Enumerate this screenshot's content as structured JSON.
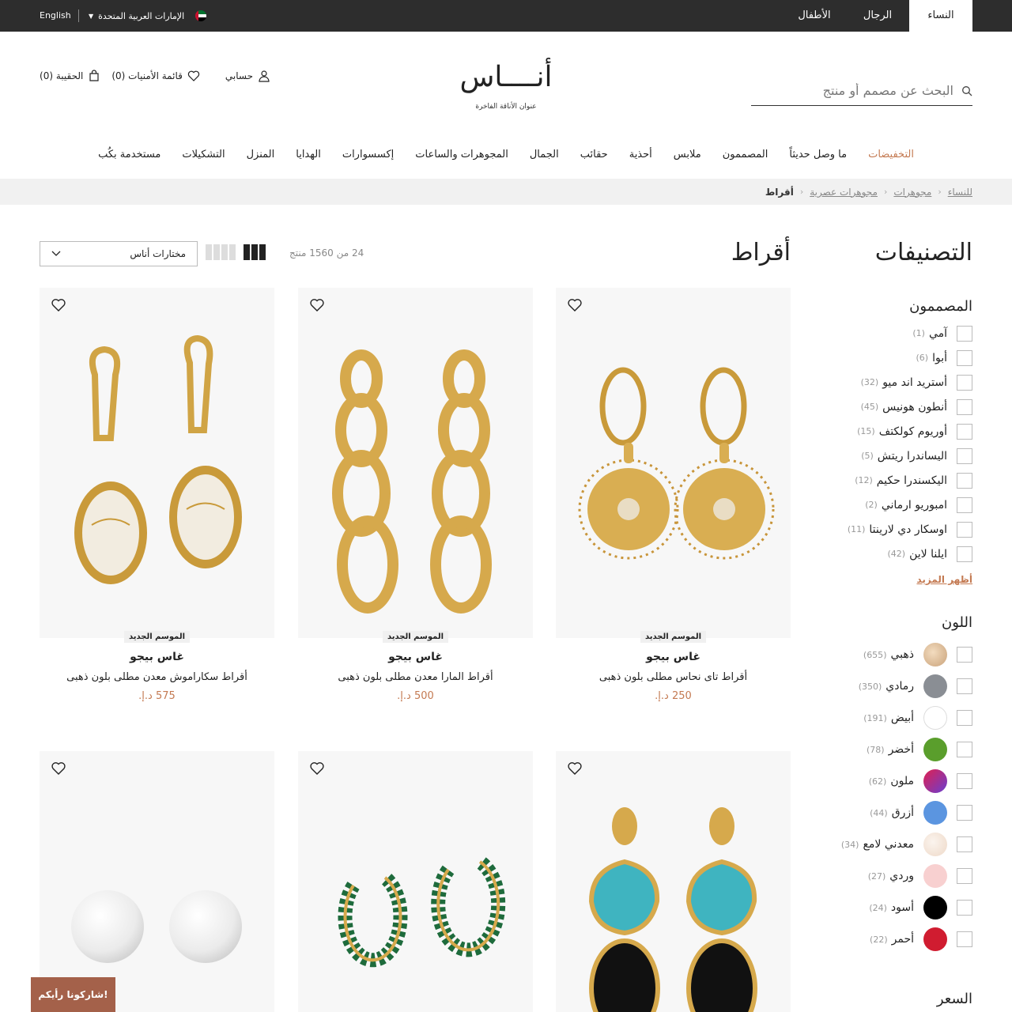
{
  "topbar": {
    "tabs": [
      "النساء",
      "الرجال",
      "الأطفال"
    ],
    "language": "English",
    "region": "الإمارات العربية المتحدة"
  },
  "header": {
    "account": "حسابي",
    "wishlist": "قائمة الأمنيات (0)",
    "bag": "الحقيبة (0)",
    "logo_text": "أنــــاس",
    "logo_tagline": "عنوان الأناقة الفاخرة",
    "search_placeholder": "البحث عن مصمم أو منتج"
  },
  "nav": [
    "التخفيضات",
    "ما وصل حديثاً",
    "المصممون",
    "ملابس",
    "أحذية",
    "حقائب",
    "الجمال",
    "المجوهرات والساعات",
    "إكسسوارات",
    "الهدايا",
    "المنزل",
    "التشكيلات",
    "مستخدمة بكُب"
  ],
  "breadcrumb": [
    "للنساء",
    "مجوهرات",
    "مجوهرات عصرية"
  ],
  "breadcrumb_current": "أقراط",
  "sidebar": {
    "title": "التصنيفات",
    "designers_title": "المصممون",
    "designers": [
      {
        "name": "آمي",
        "count": "(1)"
      },
      {
        "name": "أبوا",
        "count": "(6)"
      },
      {
        "name": "أستريد اند ميو",
        "count": "(32)"
      },
      {
        "name": "أنطون هونيس",
        "count": "(45)"
      },
      {
        "name": "أوريوم كولكتف",
        "count": "(15)"
      },
      {
        "name": "اليساندرا ريتش",
        "count": "(5)"
      },
      {
        "name": "اليكسندرا حكيم",
        "count": "(12)"
      },
      {
        "name": "امبوريو ارماني",
        "count": "(2)"
      },
      {
        "name": "اوسكار دي لارينتا",
        "count": "(11)"
      },
      {
        "name": "ايلنا لاين",
        "count": "(42)"
      }
    ],
    "show_more": "أظهر المزيد",
    "color_title": "اللون",
    "colors": [
      {
        "name": "ذهبي",
        "count": "(655)",
        "hex": "#e8c9a4"
      },
      {
        "name": "رمادي",
        "count": "(350)",
        "hex": "#8a8e94"
      },
      {
        "name": "أبيض",
        "count": "(191)",
        "hex": "#ffffff"
      },
      {
        "name": "أخضر",
        "count": "(78)",
        "hex": "#5a9e2c"
      },
      {
        "name": "ملون",
        "count": "(62)",
        "hex": "#c0305a"
      },
      {
        "name": "أزرق",
        "count": "(44)",
        "hex": "#5b95e0"
      },
      {
        "name": "معدني لامع",
        "count": "(34)",
        "hex": "#f0e2d6"
      },
      {
        "name": "وردي",
        "count": "(27)",
        "hex": "#f8d0d0"
      },
      {
        "name": "أسود",
        "count": "(24)",
        "hex": "#000000"
      },
      {
        "name": "أحمر",
        "count": "(22)",
        "hex": "#d01c30"
      }
    ],
    "price_title": "السعر"
  },
  "listing": {
    "title": "أقراط",
    "count_text": "24 من 1560 منتج",
    "sort_label": "مختارات أناس"
  },
  "products": [
    {
      "badge": "الموسم الجديد",
      "brand": "غاس بيجو",
      "desc": "أقراط تاى نحاس مطلى بلون ذهبى",
      "price": "250 د.إ.",
      "icon": "sun-earrings-image"
    },
    {
      "badge": "الموسم الجديد",
      "brand": "غاس بيجو",
      "desc": "أقراط المارا معدن مطلى بلون ذهبى",
      "price": "500 د.إ.",
      "icon": "chain-earrings-image"
    },
    {
      "badge": "الموسم الجديد",
      "brand": "غاس بيجو",
      "desc": "أقراط سكاراموش معدن مطلى بلون ذهبى",
      "price": "575 د.إ.",
      "icon": "scarab-earrings-image"
    },
    {
      "icon": "turquoise-earrings-image"
    },
    {
      "icon": "green-hoop-earrings-image"
    },
    {
      "icon": "pearl-earrings-image"
    }
  ],
  "feedback": "شاركونا رأيكم!",
  "colors": {
    "accent": "#c47a52",
    "topbar": "#2d2d2d",
    "feedback": "#a4614a"
  }
}
